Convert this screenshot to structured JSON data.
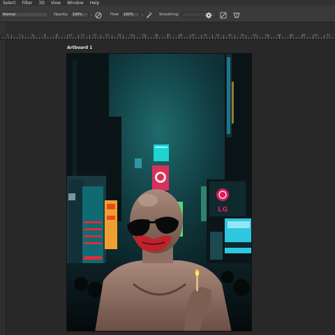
{
  "menu": [
    "Select",
    "Filter",
    "3D",
    "View",
    "Window",
    "Help"
  ],
  "options": {
    "mode_value": "Normal",
    "opacity_label": "Opacity:",
    "opacity_value": "100%",
    "flow_label": "Flow:",
    "flow_value": "100%",
    "smoothing_label": "Smoothing:",
    "smoothing_value": ""
  },
  "ruler_numbers": [
    "0",
    "2",
    "4",
    "6",
    "8",
    "10",
    "12",
    "14",
    "16",
    "18",
    "20",
    "22",
    "24",
    "26",
    "28",
    "30",
    "32",
    "34",
    "36",
    "38",
    "40",
    "42",
    "44",
    "46",
    "48",
    "50",
    "52",
    "54"
  ],
  "artboard": {
    "label": "Artboard 1",
    "sign_text": "LG"
  },
  "colors": {
    "accent_teal": "#19c9c0",
    "lg_magenta": "#d81e5b"
  }
}
